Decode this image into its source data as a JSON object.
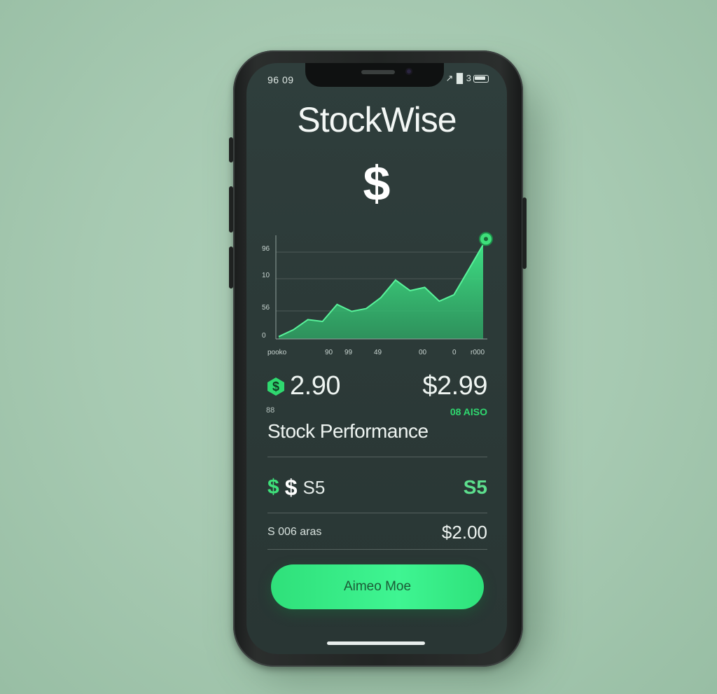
{
  "status_bar": {
    "time": "96 09",
    "signal": "↗▐▌3"
  },
  "app": {
    "title": "StockWise",
    "logo_symbol": "$"
  },
  "chart_data": {
    "type": "area",
    "x": [
      0,
      1,
      2,
      3,
      4,
      5,
      6,
      7,
      8,
      9,
      10,
      11,
      12,
      13,
      14
    ],
    "values": [
      5,
      20,
      42,
      38,
      75,
      60,
      66,
      90,
      128,
      105,
      112,
      82,
      96,
      150,
      205
    ],
    "y_tick_labels": [
      "96",
      "10",
      "56",
      "0"
    ],
    "x_tick_labels": [
      "pooko",
      "90",
      "99",
      "49",
      "00",
      "0",
      "r000"
    ],
    "grid": true,
    "line_color": "#3fe888",
    "fill_color": "#3fd882",
    "endpoint_marker": true
  },
  "price": {
    "current": "2.90",
    "right": "$2.99",
    "change": "08 AISO",
    "sub_left": "88"
  },
  "section": {
    "title": "Stock Performance"
  },
  "rows": [
    {
      "label": "S5",
      "value": "S5"
    },
    {
      "label": "S 006 aras",
      "value": "$2.00"
    }
  ],
  "cta": {
    "label": "Aimeo Moe"
  },
  "colors": {
    "accent": "#3ee07a",
    "screen_bg": "#2e3c3a",
    "page_bg": "#a8caB2"
  }
}
